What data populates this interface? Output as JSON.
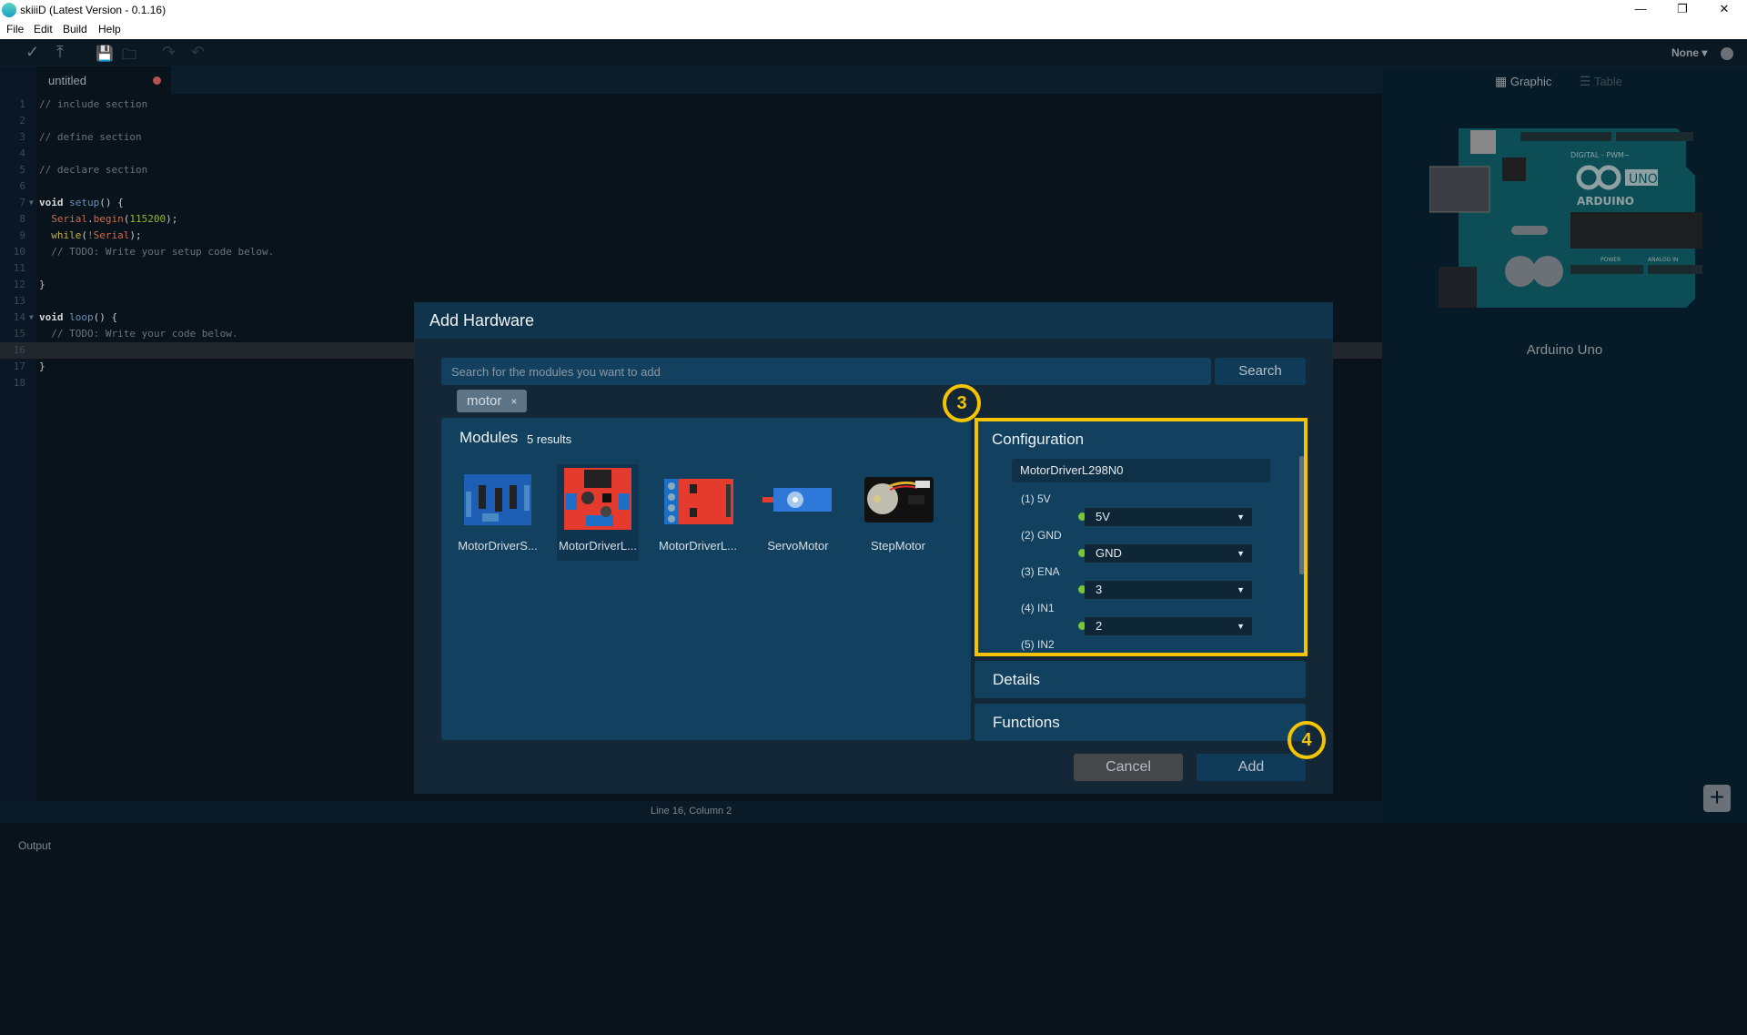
{
  "window": {
    "title": "skiiiD (Latest Version - 0.1.16)",
    "controls": {
      "minimize": "—",
      "restore": "❐",
      "close": "✕"
    }
  },
  "menu": [
    "File",
    "Edit",
    "Build",
    "Help"
  ],
  "toolbar": {
    "icons": [
      "verify-icon",
      "upload-icon",
      "save-icon",
      "open-folder-icon",
      "redo-icon",
      "undo-icon"
    ],
    "board_select": "None ▾"
  },
  "editor": {
    "tab_name": "untitled",
    "lines": [
      {
        "n": "1",
        "text": "// include section"
      },
      {
        "n": "2",
        "text": ""
      },
      {
        "n": "3",
        "text": "// define section"
      },
      {
        "n": "4",
        "text": ""
      },
      {
        "n": "5",
        "text": "// declare section"
      },
      {
        "n": "6",
        "text": ""
      },
      {
        "n": "7",
        "text": "void setup() {"
      },
      {
        "n": "8",
        "text": "  Serial.begin(115200);"
      },
      {
        "n": "9",
        "text": "  while(!Serial);"
      },
      {
        "n": "10",
        "text": "  // TODO: Write your setup code below."
      },
      {
        "n": "11",
        "text": ""
      },
      {
        "n": "12",
        "text": "}"
      },
      {
        "n": "13",
        "text": ""
      },
      {
        "n": "14",
        "text": "void loop() {"
      },
      {
        "n": "15",
        "text": "  // TODO: Write your code below."
      },
      {
        "n": "16",
        "text": ""
      },
      {
        "n": "17",
        "text": "}"
      },
      {
        "n": "18",
        "text": ""
      }
    ],
    "current_line": 16,
    "status": "Line 16, Column 2"
  },
  "output": {
    "label": "Output"
  },
  "right_panel": {
    "view_tabs": {
      "graphic": "Graphic",
      "table": "Table"
    },
    "board_name": "Arduino Uno",
    "board_text": {
      "brand": "ARDUINO",
      "model": "UNO",
      "digital": "DIGITAL - PWM~",
      "power": "POWER",
      "analog": "ANALOG IN"
    },
    "add_label": "+"
  },
  "dialog": {
    "title": "Add Hardware",
    "search": {
      "placeholder": "Search for the modules you want to add",
      "value": "",
      "button": "Search"
    },
    "tags": [
      {
        "label": "motor",
        "remove": "×"
      }
    ],
    "modules": {
      "title": "Modules",
      "count": "5 results",
      "items": [
        {
          "name": "MotorDriverS...",
          "selected": false
        },
        {
          "name": "MotorDriverL...",
          "selected": true
        },
        {
          "name": "MotorDriverL...",
          "selected": false
        },
        {
          "name": "ServoMotor",
          "selected": false
        },
        {
          "name": "StepMotor",
          "selected": false
        }
      ]
    },
    "configuration": {
      "title": "Configuration",
      "instance_name": "MotorDriverL298N0",
      "pins": [
        {
          "label": "(1) 5V",
          "value": "5V"
        },
        {
          "label": "(2) GND",
          "value": "GND"
        },
        {
          "label": "(3) ENA",
          "value": "3"
        },
        {
          "label": "(4) IN1",
          "value": "2"
        },
        {
          "label": "(5) IN2",
          "value": ""
        }
      ]
    },
    "details_label": "Details",
    "functions_label": "Functions",
    "cancel_label": "Cancel",
    "add_label": "Add"
  },
  "annotations": [
    {
      "step": "3"
    },
    {
      "step": "4"
    }
  ]
}
